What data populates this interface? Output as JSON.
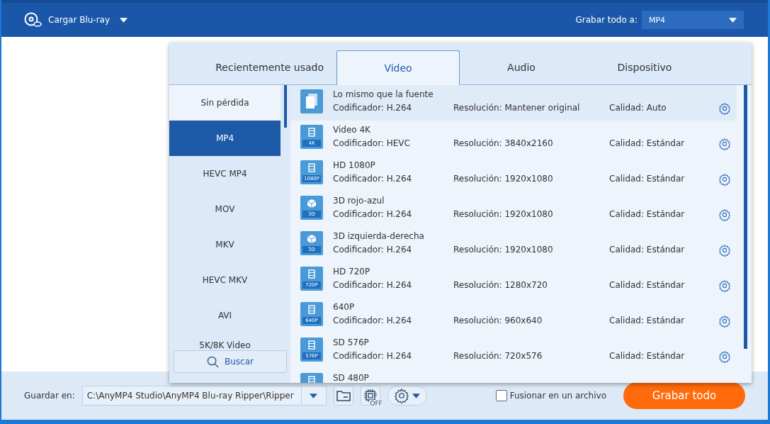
{
  "toolbar": {
    "load_button": "Cargar Blu-ray",
    "convert_all_label": "Grabar todo a:",
    "convert_all_value": "MP4"
  },
  "format_panel": {
    "tabs": [
      {
        "label": "Recientemente usado",
        "selected": false
      },
      {
        "label": "Video",
        "selected": true
      },
      {
        "label": "Audio",
        "selected": false
      },
      {
        "label": "Dispositivo",
        "selected": false
      }
    ],
    "categories": [
      {
        "label": "Sin pérdida",
        "selected": false
      },
      {
        "label": "MP4",
        "selected": true
      },
      {
        "label": "HEVC MP4",
        "selected": false
      },
      {
        "label": "MOV",
        "selected": false
      },
      {
        "label": "MKV",
        "selected": false
      },
      {
        "label": "HEVC MKV",
        "selected": false
      },
      {
        "label": "AVI",
        "selected": false
      },
      {
        "label": "5K/8K Video",
        "selected": false
      }
    ],
    "search_button": "Buscar",
    "profiles": [
      {
        "kind": "copy",
        "name": "Lo mismo que la fuente",
        "encoder": "Codificador: H.264",
        "resolution": "Resolución: Mantener original",
        "quality": "Calidad: Auto",
        "selected": true
      },
      {
        "kind": "film",
        "badge": "4K",
        "name": "Video 4K",
        "encoder": "Codificador: HEVC",
        "resolution": "Resolución: 3840x2160",
        "quality": "Calidad: Estándar",
        "selected": false
      },
      {
        "kind": "film",
        "badge": "1080P",
        "name": "HD 1080P",
        "encoder": "Codificador: H.264",
        "resolution": "Resolución: 1920x1080",
        "quality": "Calidad: Estándar",
        "selected": false
      },
      {
        "kind": "cube",
        "badge": "3D",
        "name": "3D rojo-azul",
        "encoder": "Codificador: H.264",
        "resolution": "Resolución: 1920x1080",
        "quality": "Calidad: Estándar",
        "selected": false
      },
      {
        "kind": "cube",
        "badge": "3D",
        "name": "3D izquierda-derecha",
        "encoder": "Codificador: H.264",
        "resolution": "Resolución: 1920x1080",
        "quality": "Calidad: Estándar",
        "selected": false
      },
      {
        "kind": "film",
        "badge": "720P",
        "name": "HD 720P",
        "encoder": "Codificador: H.264",
        "resolution": "Resolución: 1280x720",
        "quality": "Calidad: Estándar",
        "selected": false
      },
      {
        "kind": "film",
        "badge": "640P",
        "name": "640P",
        "encoder": "Codificador: H.264",
        "resolution": "Resolución: 960x640",
        "quality": "Calidad: Estándar",
        "selected": false
      },
      {
        "kind": "film",
        "badge": "576P",
        "name": "SD 576P",
        "encoder": "Codificador: H.264",
        "resolution": "Resolución: 720x576",
        "quality": "Calidad: Estándar",
        "selected": false
      },
      {
        "kind": "film",
        "name": "SD 480P",
        "selected": false
      }
    ]
  },
  "bottom_bar": {
    "save_label": "Guardar en:",
    "path": "C:\\AnyMP4 Studio\\AnyMP4 Blu-ray Ripper\\Ripper",
    "cpu_badge": "OFF",
    "merge": {
      "label": "Fusionar en un archivo",
      "checked": false
    },
    "convert_button": "Grabar todo"
  }
}
